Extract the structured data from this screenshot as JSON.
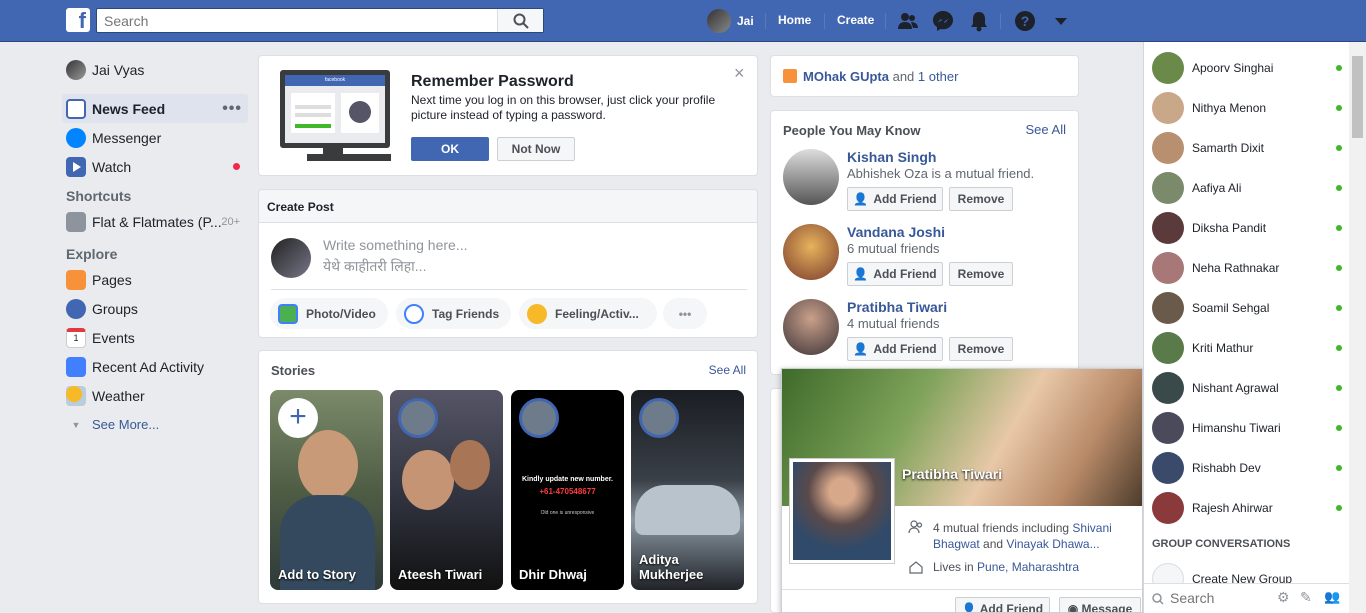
{
  "topbar": {
    "search_placeholder": "Search",
    "user_name": "Jai",
    "home": "Home",
    "create": "Create",
    "brand_color": "#4267b2"
  },
  "left_nav": {
    "profile_name": "Jai Vyas",
    "items": [
      {
        "label": "News Feed",
        "icon": "news-feed-icon"
      },
      {
        "label": "Messenger",
        "icon": "messenger-icon"
      },
      {
        "label": "Watch",
        "icon": "watch-icon"
      }
    ],
    "shortcuts_heading": "Shortcuts",
    "shortcut": {
      "label": "Flat & Flatmates (P...",
      "badge": "20+"
    },
    "explore_heading": "Explore",
    "explore": [
      {
        "label": "Pages",
        "icon": "flag-icon"
      },
      {
        "label": "Groups",
        "icon": "groups-icon"
      },
      {
        "label": "Events",
        "icon": "calendar-icon",
        "day": "1"
      },
      {
        "label": "Recent Ad Activity",
        "icon": "ad-activity-icon"
      },
      {
        "label": "Weather",
        "icon": "weather-icon"
      }
    ],
    "see_more": "See More..."
  },
  "remember": {
    "title": "Remember Password",
    "body": "Next time you log in on this browser, just click your profile picture instead of typing a password.",
    "ok": "OK",
    "not_now": "Not Now",
    "close": "×",
    "mock_brand": "facebook"
  },
  "create_post": {
    "header": "Create Post",
    "placeholder_en": "Write something here...",
    "placeholder_mr": "येथे काहीतरी लिहा...",
    "actions": [
      "Photo/Video",
      "Tag Friends",
      "Feeling/Activ...",
      "•••"
    ]
  },
  "stories": {
    "heading": "Stories",
    "see_all": "See All",
    "items": [
      {
        "name": "Add to Story"
      },
      {
        "name": "Ateesh Tiwari"
      },
      {
        "name": "Dhir Dhwaj",
        "text1": "Kindly update new number.",
        "text2": "+61-470548677",
        "text3": "Old one is unresponsive"
      },
      {
        "name": "Aditya Mukherjee"
      }
    ]
  },
  "birthday": {
    "name": "MOhak GUpta",
    "and": "and",
    "other": "1 other"
  },
  "pymk": {
    "heading": "People You May Know",
    "see_all": "See All",
    "add_friend": "Add Friend",
    "remove": "Remove",
    "people": [
      {
        "name": "Kishan Singh",
        "mutual": "Abhishek Oza is a mutual friend."
      },
      {
        "name": "Vandana Joshi",
        "mutual": "6 mutual friends"
      },
      {
        "name": "Pratibha Tiwari",
        "mutual": "4 mutual friends"
      }
    ]
  },
  "hovercard": {
    "name": "Pratibha Tiwari",
    "mutual_prefix": "4 mutual friends including",
    "mutual_1": "Shivani Bhagwat",
    "mutual_and": "and",
    "mutual_2": "Vinayak Dhawa...",
    "lives_prefix": "Lives in",
    "lives_place": "Pune, Maharashtra",
    "add_friend": "Add Friend",
    "message": "Message"
  },
  "chat": {
    "contacts": [
      "Apoorv Singhai",
      "Nithya Menon",
      "Samarth Dixit",
      "Aafiya Ali",
      "Diksha Pandit",
      "Neha Rathnakar",
      "Soamil Sehgal",
      "Kriti Mathur",
      "Nishant Agrawal",
      "Himanshu Tiwari",
      "Rishabh Dev",
      "Rajesh Ahirwar"
    ],
    "group_heading": "GROUP CONVERSATIONS",
    "create_group": "Create New Group",
    "search_placeholder": "Search",
    "online_color": "#42b72a"
  }
}
